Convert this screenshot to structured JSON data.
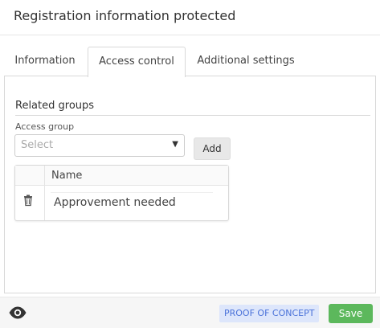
{
  "header": {
    "title": "Registration information protected"
  },
  "tabs": [
    {
      "label": "Information",
      "active": false
    },
    {
      "label": "Access control",
      "active": true
    },
    {
      "label": "Additional settings",
      "active": false
    }
  ],
  "related_groups": {
    "title": "Related groups",
    "access_group_label": "Access group",
    "select_placeholder": "Select",
    "add_label": "Add",
    "table": {
      "columns": [
        "Name"
      ],
      "rows": [
        {
          "name": "Approvement needed"
        }
      ]
    }
  },
  "footer": {
    "badge": "PROOF OF CONCEPT",
    "save_label": "Save"
  },
  "colors": {
    "accent_save": "#5cb85c",
    "badge_bg": "#dde6fb",
    "badge_text": "#4a72d9"
  },
  "icons": {
    "row_delete": "trash-icon",
    "visibility": "eye-icon",
    "select_caret": "caret-down-icon"
  }
}
